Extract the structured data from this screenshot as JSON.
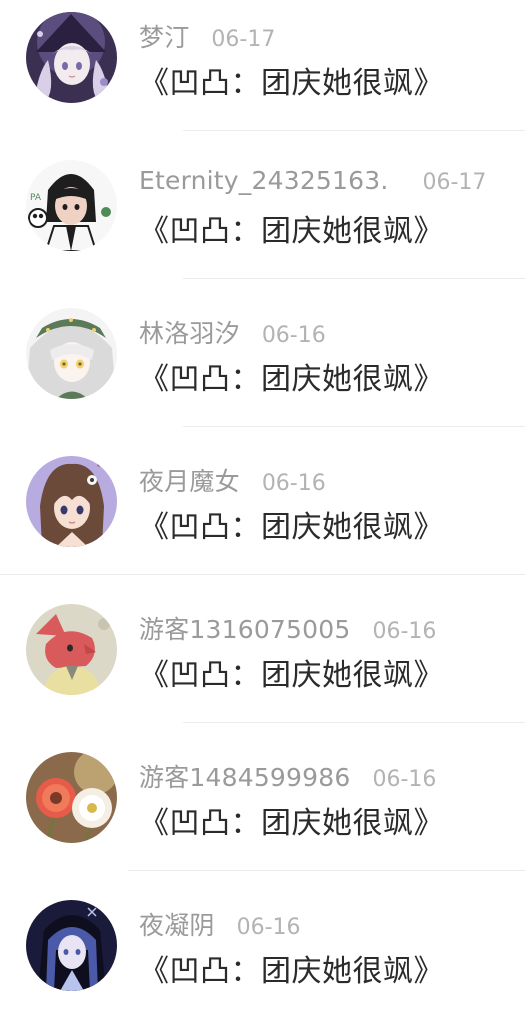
{
  "comments": [
    {
      "name": "梦汀",
      "date": "06-17",
      "message": "《凹凸：团庆她很飒》",
      "avatar": "anime-girl-witch-hat-avatar",
      "palette": [
        "#3b2f52",
        "#7a6aa8",
        "#d9cfe6",
        "#f3ecef"
      ]
    },
    {
      "name": "Eternity_24325163.",
      "date": "06-17",
      "message": "《凹凸：团庆她很飒》",
      "avatar": "anime-girl-panda-avatar",
      "palette": [
        "#f7f7f7",
        "#1e1e1e",
        "#f0d2c4",
        "#4f8a5b"
      ]
    },
    {
      "name": "林洛羽汐",
      "date": "06-16",
      "message": "《凹凸：团庆她很飒》",
      "avatar": "anime-white-hair-avatar",
      "palette": [
        "#f4f4f4",
        "#dadada",
        "#f2cf6b",
        "#5b7a5a"
      ]
    },
    {
      "name": "夜月魔女",
      "date": "06-16",
      "message": "《凹凸：团庆她很飒》",
      "avatar": "anime-brown-hair-girl-avatar",
      "palette": [
        "#b7abe0",
        "#6b4a3a",
        "#f6e0d4",
        "#3a3a6a"
      ]
    },
    {
      "name": "游客1316075005",
      "date": "06-16",
      "message": "《凹凸：团庆她很飒》",
      "avatar": "fox-character-avatar",
      "palette": [
        "#dcd8c8",
        "#d95a5a",
        "#e9dfa0",
        "#8a8a7a"
      ]
    },
    {
      "name": "游客1484599986",
      "date": "06-16",
      "message": "《凹凸：团庆她很飒》",
      "avatar": "flower-photo-avatar",
      "palette": [
        "#8a6a4a",
        "#e85a4a",
        "#f4eee4",
        "#c9b07a"
      ]
    },
    {
      "name": "夜凝阴",
      "date": "06-16",
      "message": "《凹凸：团庆她很飒》",
      "avatar": "dark-anime-girl-avatar",
      "palette": [
        "#1a1a3a",
        "#4a5aa8",
        "#b8c4ee",
        "#0e0e1e"
      ]
    }
  ]
}
